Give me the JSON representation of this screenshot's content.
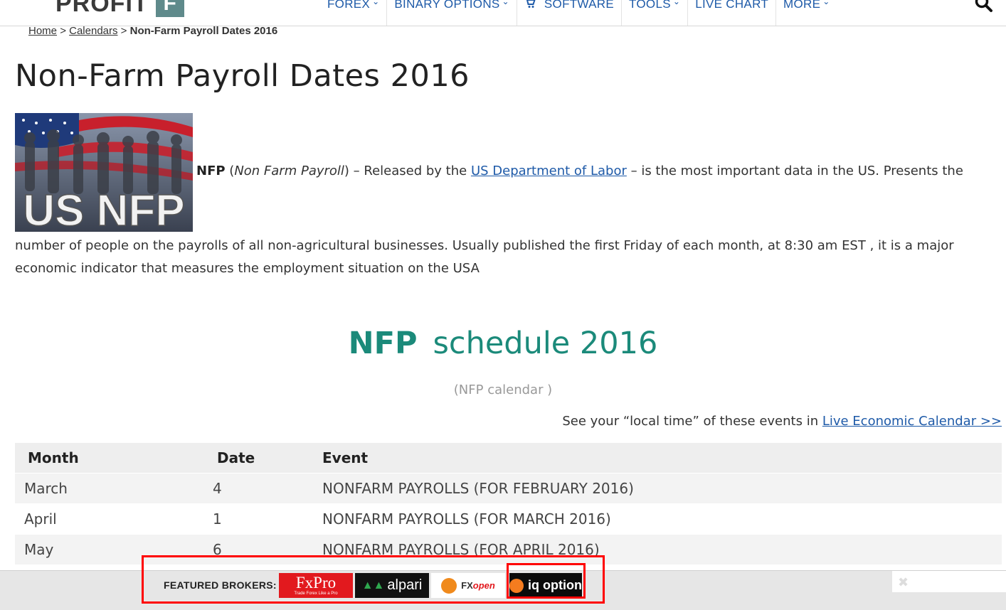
{
  "header": {
    "logo_text": "PROFIT",
    "logo_box": "F",
    "nav": [
      {
        "label": "FOREX",
        "dropdown": true
      },
      {
        "label": "BINARY OPTIONS",
        "dropdown": true
      },
      {
        "label": "SOFTWARE",
        "dropdown": false,
        "icon": "cart-icon"
      },
      {
        "label": "TOOLS",
        "dropdown": true
      },
      {
        "label": "LIVE CHART",
        "dropdown": false
      },
      {
        "label": "MORE",
        "dropdown": true
      }
    ]
  },
  "breadcrumb": {
    "home": "Home",
    "sep1": ">",
    "calendars": "Calendars",
    "sep2": ">",
    "current": "Non-Farm Payroll Dates 2016"
  },
  "page_title": "Non-Farm Payroll Dates 2016",
  "image_text": "US NFP",
  "intro": {
    "bold": "NFP",
    "paren_open": " (",
    "italic": "Non Farm Payroll",
    "text1": ") – Released by the ",
    "link": "US Department of Labor",
    "text2": " – is the most important data in the US. Presents the",
    "rest": "number of people on the payrolls of all non-agricultural businesses. Usually published the first Friday of each month, at 8:30 am EST , it is a major economic indicator that measures the employment situation on the USA"
  },
  "schedule": {
    "title_bold": "NFP",
    "title_rest": "schedule 2016",
    "subtitle": "(NFP calendar )",
    "note_text": "See your “local time” of these events in ",
    "note_link": "Live Economic Calendar >>"
  },
  "table": {
    "headers": [
      "Month",
      "Date",
      "Event"
    ],
    "rows": [
      [
        "March",
        "4",
        "NONFARM PAYROLLS (FOR FEBRUARY 2016)"
      ],
      [
        "April",
        "1",
        "NONFARM PAYROLLS (FOR MARCH 2016)"
      ],
      [
        "May",
        "6",
        "NONFARM PAYROLLS (FOR APRIL 2016)"
      ]
    ]
  },
  "brokers": {
    "label": "FEATURED BROKERS:",
    "fxpro_name": "FxPro",
    "fxpro_tag": "Trade Forex Like a Pro",
    "alpari": "alpari",
    "fxopen_fx": "FX",
    "fxopen_open": "open",
    "iq": "iq option"
  },
  "colors": {
    "accent_teal": "#1b8a7a",
    "link_blue": "#1e5aa8",
    "highlight_red": "#ff0000"
  }
}
